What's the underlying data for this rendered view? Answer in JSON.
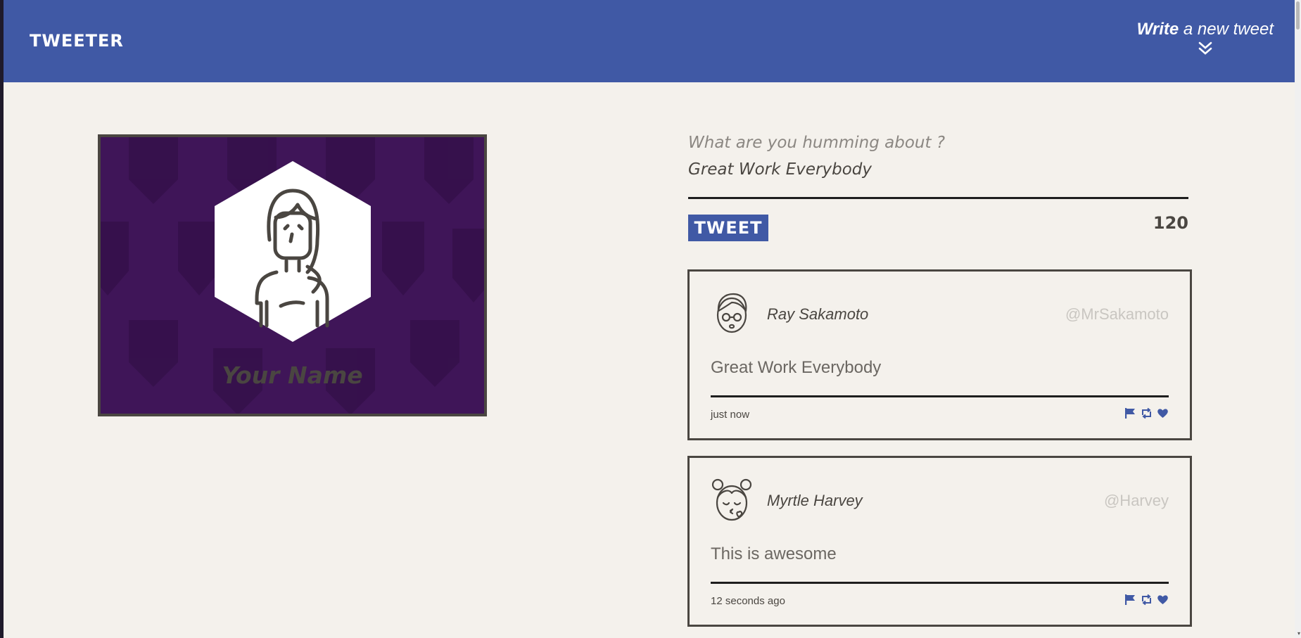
{
  "navbar": {
    "brand": "TWEETER",
    "compose_bold": "Write",
    "compose_rest": " a new tweet",
    "toggle_icon": "double-chevron-down-icon",
    "bg_color": "#4059a5"
  },
  "profile": {
    "name": "Your Name",
    "avatar_icon": "woman-avatar-icon",
    "bg_color": "#3f1558"
  },
  "composer": {
    "prompt": "What are you humming about ?",
    "draft": "Great Work Everybody",
    "button_label": "TWEET",
    "counter": "120"
  },
  "tweets": [
    {
      "name": "Ray Sakamoto",
      "handle": "@MrSakamoto",
      "text": "Great Work Everybody",
      "time": "just now",
      "avatar_icon": "man-with-glasses-avatar-icon"
    },
    {
      "name": "Myrtle Harvey",
      "handle": "@Harvey",
      "text": "This is awesome",
      "time": "12 seconds ago",
      "avatar_icon": "girl-kiss-avatar-icon"
    }
  ],
  "action_icons": [
    "flag-icon",
    "retweet-icon",
    "heart-icon"
  ],
  "accent_color": "#4059a5"
}
